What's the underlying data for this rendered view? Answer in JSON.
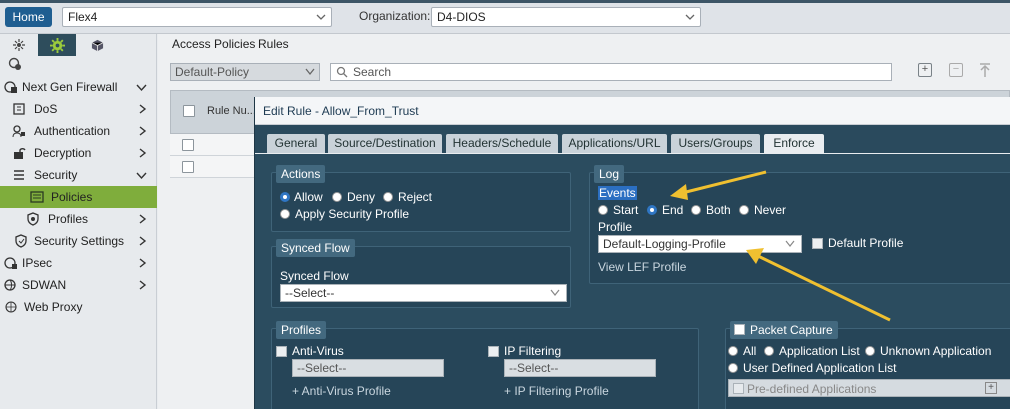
{
  "topbar": {
    "home_label": "Home",
    "appliance_select": "Flex4",
    "org_label": "Organization:",
    "org_select": "D4-DIOS"
  },
  "sidebar": {
    "tabs": [
      "network-icon",
      "gear-icon",
      "cube-icon"
    ],
    "items": [
      {
        "label": "Next Gen Firewall"
      },
      {
        "label": "DoS"
      },
      {
        "label": "Authentication"
      },
      {
        "label": "Decryption"
      },
      {
        "label": "Security"
      },
      {
        "label": "Policies"
      },
      {
        "label": "Profiles"
      },
      {
        "label": "Security Settings"
      },
      {
        "label": "IPsec"
      },
      {
        "label": "SDWAN"
      },
      {
        "label": "Web Proxy"
      }
    ]
  },
  "main": {
    "tabs": [
      "Access Policies",
      "Rules"
    ],
    "policy_select": "Default-Policy",
    "search_placeholder": "Search",
    "grid_header": "Rule Nu..."
  },
  "dialog": {
    "title": "Edit Rule - Allow_From_Trust",
    "tabs": [
      "General",
      "Source/Destination",
      "Headers/Schedule",
      "Applications/URL",
      "Users/Groups",
      "Enforce"
    ],
    "actions": {
      "legend": "Actions",
      "options": [
        "Allow",
        "Deny",
        "Reject",
        "Apply Security Profile"
      ]
    },
    "synced_flow": {
      "legend": "Synced Flow",
      "label": "Synced Flow",
      "select": "--Select--"
    },
    "log": {
      "legend": "Log",
      "events_label": "Events",
      "event_options": [
        "Start",
        "End",
        "Both",
        "Never"
      ],
      "profile_label": "Profile",
      "profile_select": "Default-Logging-Profile",
      "default_profile_label": "Default Profile",
      "view_lef": "View LEF Profile"
    },
    "profiles": {
      "legend": "Profiles",
      "antivirus_label": "Anti-Virus",
      "antivirus_select": "--Select--",
      "antivirus_link": "+ Anti-Virus Profile",
      "ipfilter_label": "IP Filtering",
      "ipfilter_select": "--Select--",
      "ipfilter_link": "+ IP Filtering Profile"
    },
    "packet_capture": {
      "legend": "Packet Capture",
      "options": [
        "All",
        "Application List",
        "Unknown Application",
        "User Defined Application List"
      ],
      "predefined": "Pre-defined Applications"
    }
  },
  "colors": {
    "accent_blue": "#1f5e91",
    "active_green": "#7fad3c",
    "dialog_bg": "#2b4c5f",
    "annotation_arrow": "#f0c030"
  }
}
